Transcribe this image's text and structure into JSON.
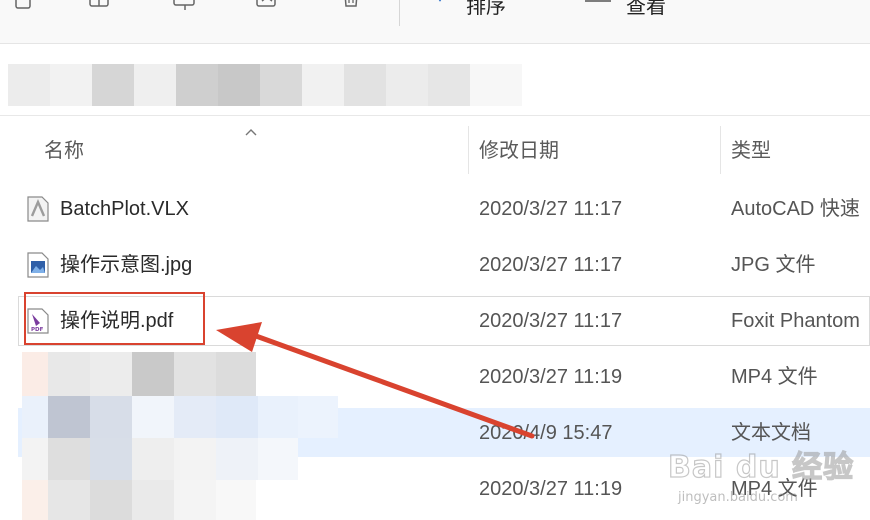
{
  "toolbar": {
    "sort_label": "排序",
    "view_label": "查看"
  },
  "columns": {
    "name": "名称",
    "date": "修改日期",
    "type": "类型"
  },
  "files": [
    {
      "name": "BatchPlot.VLX",
      "date": "2020/3/27 11:17",
      "type": "AutoCAD 快速",
      "icon": "vlx-file-icon"
    },
    {
      "name": "操作示意图.jpg",
      "date": "2020/3/27 11:17",
      "type": "JPG 文件",
      "icon": "jpg-image-icon"
    },
    {
      "name": "操作说明.pdf",
      "date": "2020/3/27 11:17",
      "type": "Foxit Phantom",
      "icon": "pdf-file-icon"
    },
    {
      "name": "",
      "date": "2020/3/27 11:19",
      "type": "MP4 文件",
      "icon": "blurred"
    },
    {
      "name": "",
      "date": "2020/4/9 15:47",
      "type": "文本文档",
      "icon": "blurred"
    },
    {
      "name": "",
      "date": "2020/3/27 11:19",
      "type": "MP4 文件",
      "icon": "blurred"
    }
  ],
  "watermark": {
    "brand": "Bai du 经验",
    "url": "jingyan.baidu.com"
  },
  "colors": {
    "annotation": "#d9432f",
    "selection": "#e5f0ff",
    "pdf_accent": "#7a3b9e"
  }
}
